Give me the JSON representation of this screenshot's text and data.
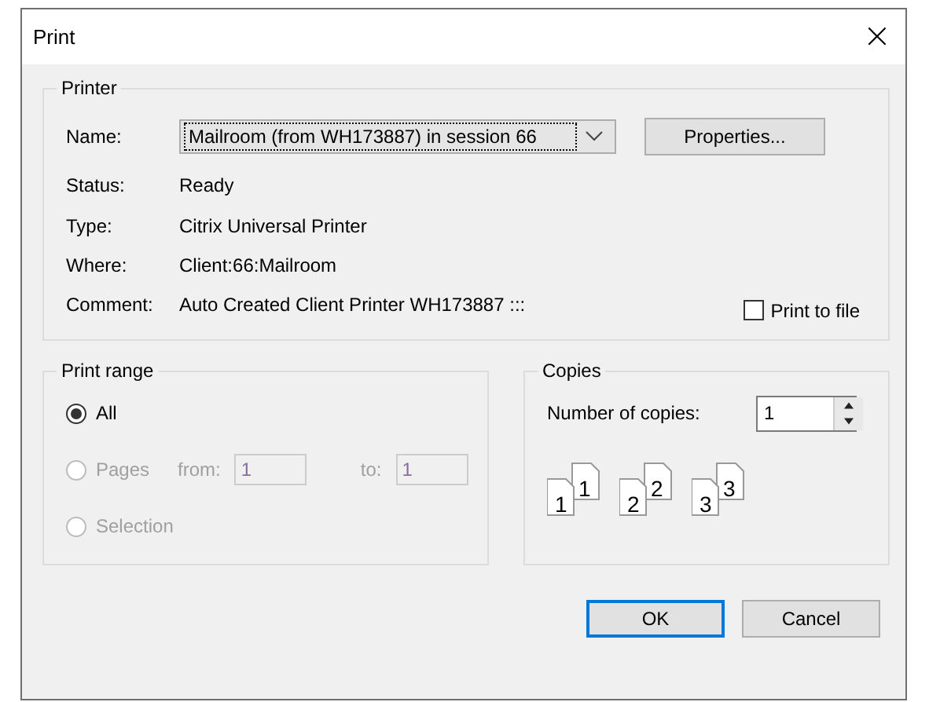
{
  "window": {
    "title": "Print",
    "close": "×"
  },
  "printer": {
    "title": "Printer",
    "name": {
      "label": "Name:",
      "value": "Mailroom (from WH173887) in session 66"
    },
    "properties_button": {
      "label": "Properties..."
    },
    "info": [
      {
        "label": "Status:",
        "value": "Ready"
      },
      {
        "label": "Type:",
        "value": "Citrix Universal Printer"
      },
      {
        "label": "Where:",
        "value": "Client:66:Mailroom"
      },
      {
        "label": "Comment:",
        "value": "Auto Created Client Printer WH173887 :::"
      }
    ],
    "print_to_file": {
      "label": "Print to file",
      "checked": false
    }
  },
  "print_range": {
    "title": "Print range",
    "options": [
      {
        "label": "All",
        "selected": true,
        "disabled": false
      },
      {
        "label": "Pages",
        "selected": false,
        "disabled": true,
        "from": {
          "label": "from:",
          "value": "1"
        },
        "to": {
          "label": "to:",
          "value": "1"
        }
      },
      {
        "label": "Selection",
        "selected": false,
        "disabled": true
      }
    ]
  },
  "copies": {
    "title": "Copies",
    "number": {
      "label": "Number of copies:",
      "value": "1"
    },
    "collate": [
      {
        "back": "1",
        "front": "1"
      },
      {
        "back": "2",
        "front": "2"
      },
      {
        "back": "3",
        "front": "3"
      }
    ]
  },
  "buttons": [
    {
      "label": "OK",
      "default": true
    },
    {
      "label": "Cancel",
      "default": false
    }
  ]
}
